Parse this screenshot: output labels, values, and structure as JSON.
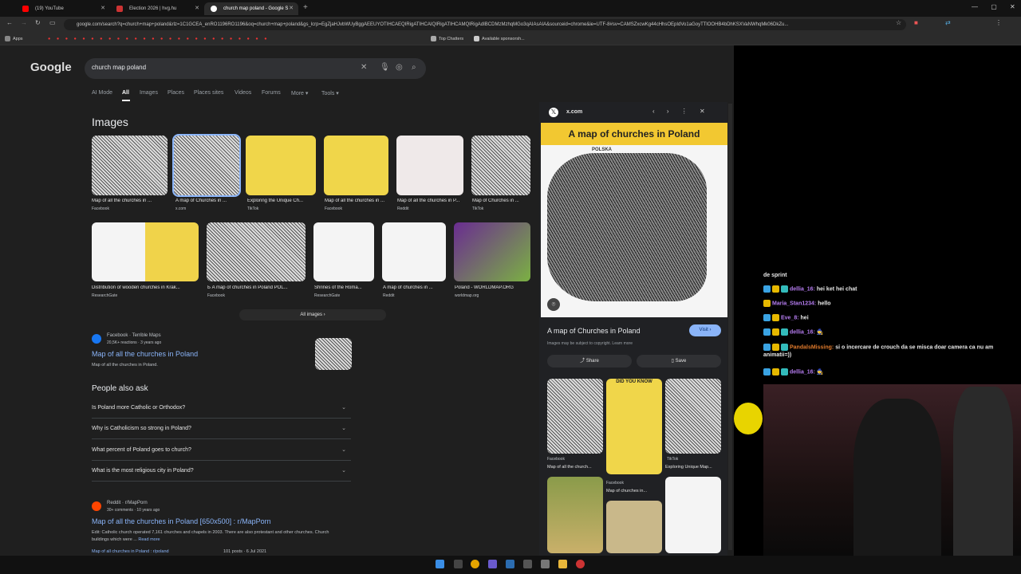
{
  "tabs": [
    {
      "title": "(19) YouTube",
      "color": "#ff0000"
    },
    {
      "title": "Election 2026 | hvg.hu",
      "color": "#d33"
    },
    {
      "title": "church map poland - Google S",
      "color": "#fff"
    }
  ],
  "url": "google.com/search?q=church+map+poland&rlz=1C1GCEA_enRO1196RO1196&oq=church+map+poland&gs_lcrp=EgZjaHJvbWUyBggAEEUYOTIHCAEQIRigATIHCAIQIRigATIHCAMQIRigAdIBCDMzMzhqMGo3qAIAsAIA&sourceid=chrome&ie=UTF-8#sv=CAMSZxcwKg44cHhsOEpIdVo1aGoyTTlOOHB4bDhKSXVaNWhqMk06DkZu...",
  "bookmarks": [
    "Apps",
    "Top Chatters",
    "Available sponsorsh..."
  ],
  "google": {
    "logo": "Google",
    "query": "church map poland",
    "nav": [
      "AI Mode",
      "All",
      "Images",
      "Places",
      "Places sites",
      "Videos",
      "Forums",
      "More ▾",
      "Tools ▾"
    ],
    "images_heading": "Images",
    "row1": [
      {
        "cap": "Map of all the churches in ...",
        "src": "Facebook"
      },
      {
        "cap": "A map of Churches in ...",
        "src": "x.com"
      },
      {
        "cap": "Exploring the Unique Ch...",
        "src": "TikTok"
      },
      {
        "cap": "Map of all the churches in ...",
        "src": "Facebook"
      },
      {
        "cap": "Map of all the churches in P...",
        "src": "Reddit"
      },
      {
        "cap": "Map of Churches in ...",
        "src": "TikTok"
      }
    ],
    "row2": [
      {
        "cap": "Distribution of wooden churches in Krak...",
        "src": "ResearchGate"
      },
      {
        "cap": "Б A map of churches in Poland POL...",
        "src": "Facebook"
      },
      {
        "cap": "Shrines of the Roma...",
        "src": "ResearchGate"
      },
      {
        "cap": "A map of churches in ...",
        "src": "Reddit"
      },
      {
        "cap": "Poland - WORLDMAP.ORG",
        "src": "worldmap.org"
      }
    ],
    "all_images": "All images  ›",
    "result1": {
      "site": "Facebook · Terrible Maps",
      "meta": "20,5K+ reactions · 3 years ago",
      "title": "Map of all the churches in Poland",
      "snippet": "Map of all the churches in Poland."
    },
    "paa_heading": "People also ask",
    "paa": [
      "Is Poland more Catholic or Orthodox?",
      "Why is Catholicism so strong in Poland?",
      "What percent of Poland goes to church?",
      "What is the most religious city in Poland?"
    ],
    "result2": {
      "site": "Reddit · r/MapPorn",
      "meta": "30+ comments · 10 years ago",
      "title": "Map of all the churches in Poland [650x500] : r/MapPorn",
      "snippet": "Edit: Catholic church operated 7,161 churches and chapels in 2003. There are also protestant and other churches. Church buildings which were ...",
      "readmore": "Read more",
      "bottom": "Map of all churches in Poland : r/poland",
      "bottom_meta": "101 posts · 6 Jul 2021"
    }
  },
  "panel": {
    "source": "x.com",
    "image_title": "A map of churches in Poland",
    "label": "POLSKA",
    "title": "A map of Churches in Poland",
    "visit": "Visit  ›",
    "copyright": "Images may be subject to copyright. Learn more",
    "share": "Share",
    "save": "Save",
    "related": [
      {
        "src": "Facebook",
        "cap": "Map of all the church..."
      },
      {
        "src": "Facebook",
        "cap": "Map of churches in..."
      },
      {
        "src": "TikTok",
        "cap": "Exploring Unique Map..."
      }
    ],
    "did_you_know": "DID YOU KNOW"
  },
  "chat": [
    {
      "user": "",
      "msg": "de sprint",
      "ucolor": "#fff"
    },
    {
      "user": "dellia_16:",
      "msg": "hei ket hei chat",
      "ucolor": "#b57cf0"
    },
    {
      "user": "Maria_Stan1234:",
      "msg": "hello",
      "ucolor": "#b57cf0"
    },
    {
      "user": "Eve_8:",
      "msg": "hei",
      "ucolor": "#b57cf0"
    },
    {
      "user": "dellia_16:",
      "msg": "🧙",
      "ucolor": "#b57cf0"
    },
    {
      "user": "PandalsMissing:",
      "msg": "si o incercare de crouch da se misca doar camera ca nu am animatii=))",
      "ucolor": "#e07a2c"
    },
    {
      "user": "dellia_16:",
      "msg": "🧙",
      "ucolor": "#b57cf0"
    }
  ]
}
